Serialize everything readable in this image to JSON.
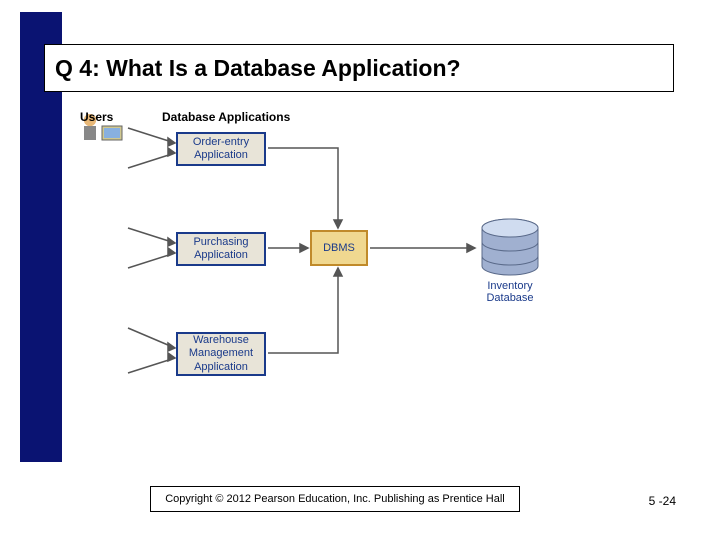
{
  "title": "Q 4: What Is a Database Application?",
  "diagram": {
    "apps": [
      "Order-entry Application",
      "Purchasing Application",
      "Warehouse Management Application"
    ],
    "dbms_label": "DBMS",
    "db_label": "Inventory Database",
    "column_labels": {
      "users": "Users",
      "apps": "Database Applications"
    }
  },
  "copyright": "Copyright © 2012 Pearson Education, Inc. Publishing as Prentice Hall",
  "page_number": "5 -24"
}
